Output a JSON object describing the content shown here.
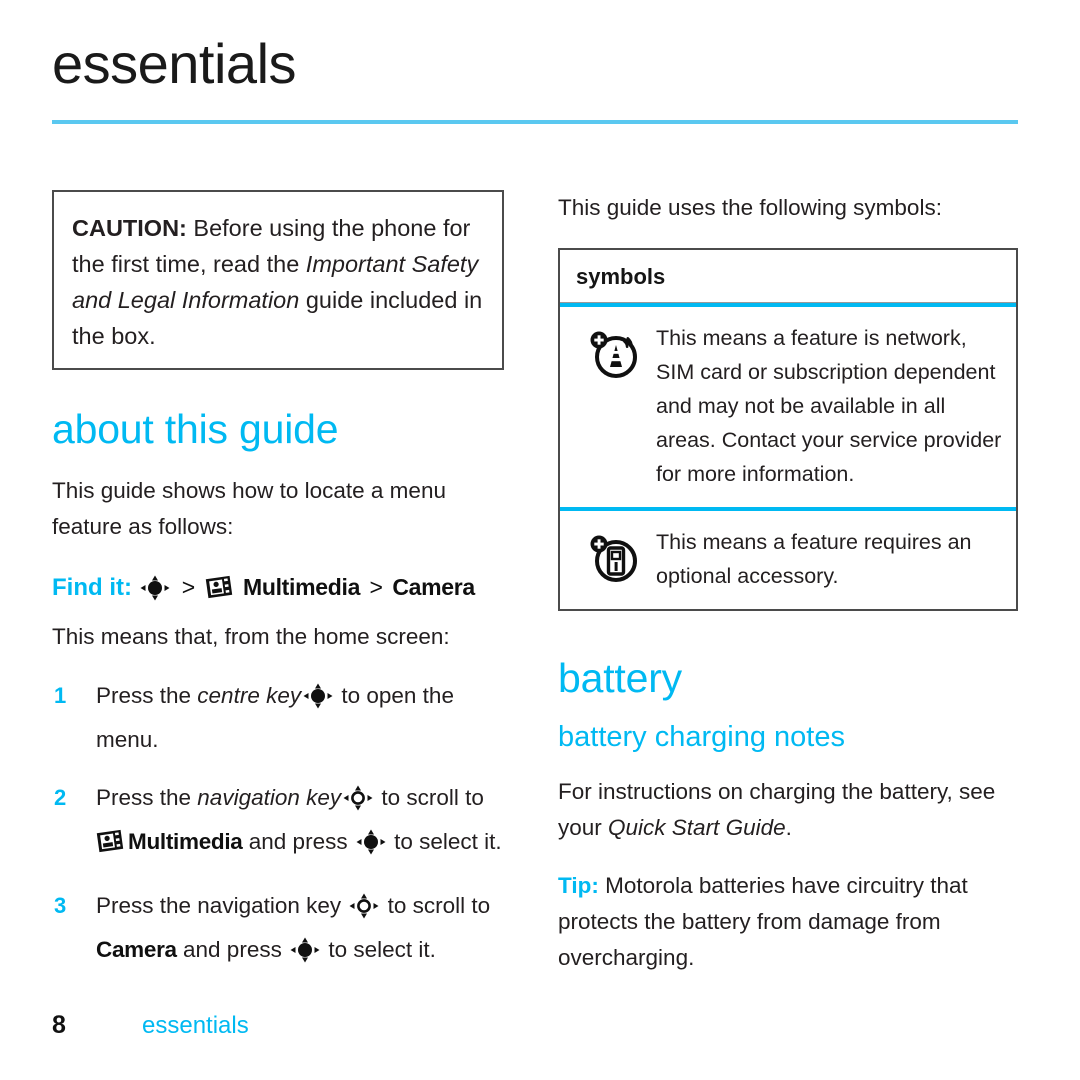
{
  "header": {
    "title": "essentials"
  },
  "left_column": {
    "caution": {
      "lead": "CAUTION:",
      "text_before_italic": " Before using the phone for the first time, read the ",
      "italic_title": "Important Safety and Legal Information",
      "text_after_italic": " guide included in the box."
    },
    "about_heading": "about this guide",
    "about_intro": "This guide shows how to locate a menu feature as follows:",
    "find_it": {
      "label": "Find it:",
      "centre_key_icon": "centre-key-icon",
      "separator": ">",
      "multimedia_icon": "multimedia-filmstrip-icon",
      "multimedia_label": "Multimedia",
      "camera_label": "Camera"
    },
    "means_text": "This means that, from the home screen:",
    "steps": [
      {
        "number": "1",
        "part1": "Press the ",
        "italic": "centre key",
        "icon": "centre-key-icon",
        "part2": " to open the menu."
      },
      {
        "number": "2",
        "part1": "Press the ",
        "italic": "navigation key",
        "icon": "navigation-key-icon",
        "part2": " to scroll to ",
        "menu_icon": "multimedia-filmstrip-icon",
        "menu_name": "Multimedia",
        "part3": " and press ",
        "icon2": "centre-key-icon",
        "part4": " to select it."
      },
      {
        "number": "3",
        "part1": "Press the navigation key ",
        "icon": "navigation-key-icon",
        "part2": " to scroll to ",
        "menu_name": "Camera",
        "part3": " and press ",
        "icon2": "centre-key-icon",
        "part4": " to select it."
      }
    ]
  },
  "right_column": {
    "symbols_intro": "This guide uses the following symbols:",
    "symbols_table": {
      "header": "symbols",
      "rows": [
        {
          "icon": "network-dependent-icon",
          "text": "This means a feature is network, SIM card or subscription dependent and may not be available in all areas. Contact your service provider for more information."
        },
        {
          "icon": "optional-accessory-icon",
          "text": "This means a feature requires an optional accessory."
        }
      ]
    },
    "battery_heading": "battery",
    "battery_sub_heading": "battery charging notes",
    "battery_para": {
      "part1": "For instructions on charging the battery, see your ",
      "italic": "Quick Start Guide",
      "part2": "."
    },
    "tip": {
      "label": "Tip:",
      "text": " Motorola batteries have circuitry that protects the battery from damage from overcharging."
    }
  },
  "footer": {
    "page_number": "8",
    "label": "essentials"
  },
  "colors": {
    "cyan": "#00b9f2",
    "rule_cyan": "#5ac8f0",
    "text": "#231f20",
    "border": "#4b4b4b"
  }
}
